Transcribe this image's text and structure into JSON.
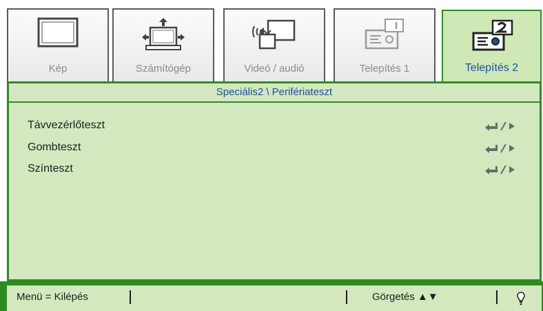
{
  "tabs": [
    {
      "label": "Kép",
      "icon": "monitor-icon",
      "active": false
    },
    {
      "label": "Számítógép",
      "icon": "computer-icon",
      "active": false
    },
    {
      "label": "Videó / audió",
      "icon": "video-audio-icon",
      "active": false
    },
    {
      "label": "Telepítés 1",
      "icon": "projector-1-icon",
      "active": false
    },
    {
      "label": "Telepítés 2",
      "icon": "projector-2-icon",
      "active": true
    }
  ],
  "breadcrumb": "Speciális2 \\ Perifériateszt",
  "items": [
    {
      "label": "Távvezérlőteszt"
    },
    {
      "label": "Gombteszt"
    },
    {
      "label": "Színteszt"
    }
  ],
  "footer": {
    "menu_exit": "Menü = Kilépés",
    "scroll": "Görgetés ▲▼"
  },
  "colors": {
    "accent": "#2e8b22",
    "panel_bg": "#d3e8bf",
    "active_label": "#1a4fa0"
  }
}
